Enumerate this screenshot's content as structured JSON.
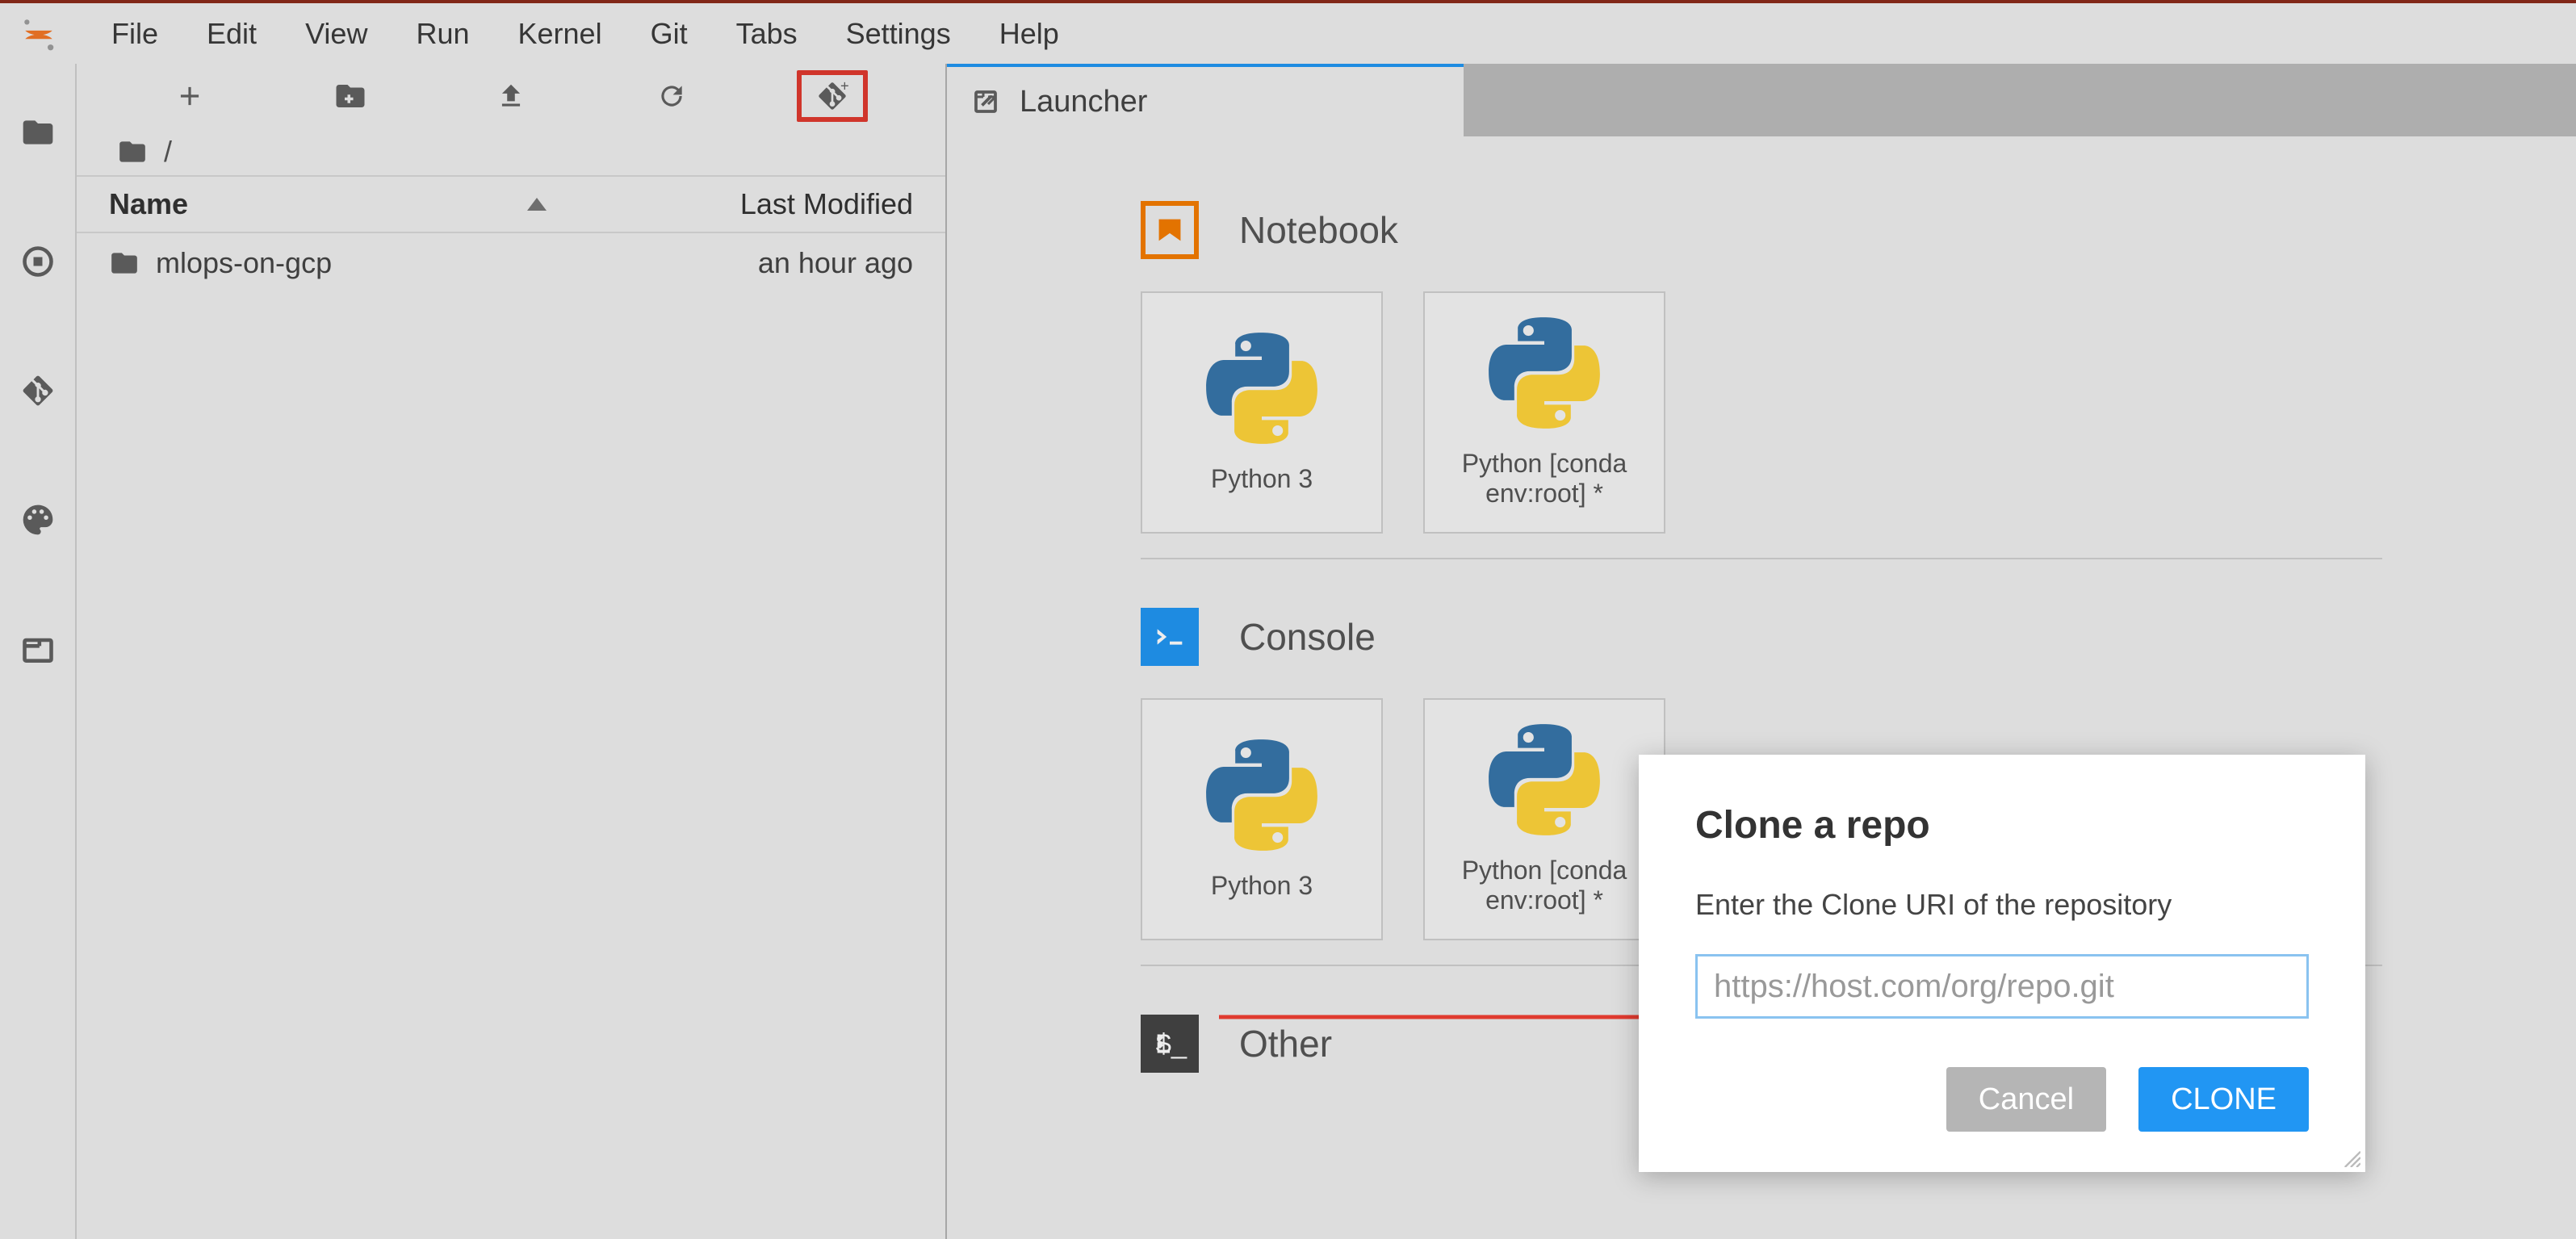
{
  "menu": {
    "items": [
      "File",
      "Edit",
      "View",
      "Run",
      "Kernel",
      "Git",
      "Tabs",
      "Settings",
      "Help"
    ]
  },
  "filebrowser": {
    "breadcrumb_root": "/",
    "columns": {
      "name": "Name",
      "modified": "Last Modified"
    },
    "rows": [
      {
        "name": "mlops-on-gcp",
        "modified": "an hour ago"
      }
    ]
  },
  "tab": {
    "title": "Launcher"
  },
  "launcher": {
    "sections": {
      "notebook": {
        "title": "Notebook",
        "cards": [
          "Python 3",
          "Python [conda env:root] *"
        ]
      },
      "console": {
        "title": "Console",
        "cards": [
          "Python 3",
          "Python [conda env:root] *"
        ]
      },
      "other": {
        "title": "Other"
      }
    }
  },
  "dialog": {
    "title": "Clone a repo",
    "prompt": "Enter the Clone URI of the repository",
    "placeholder": "https://host.com/org/repo.git",
    "cancel": "Cancel",
    "clone": "CLONE"
  },
  "colors": {
    "accent": "#2196f3",
    "highlight": "#e03a2f",
    "orange": "#f57c00"
  }
}
